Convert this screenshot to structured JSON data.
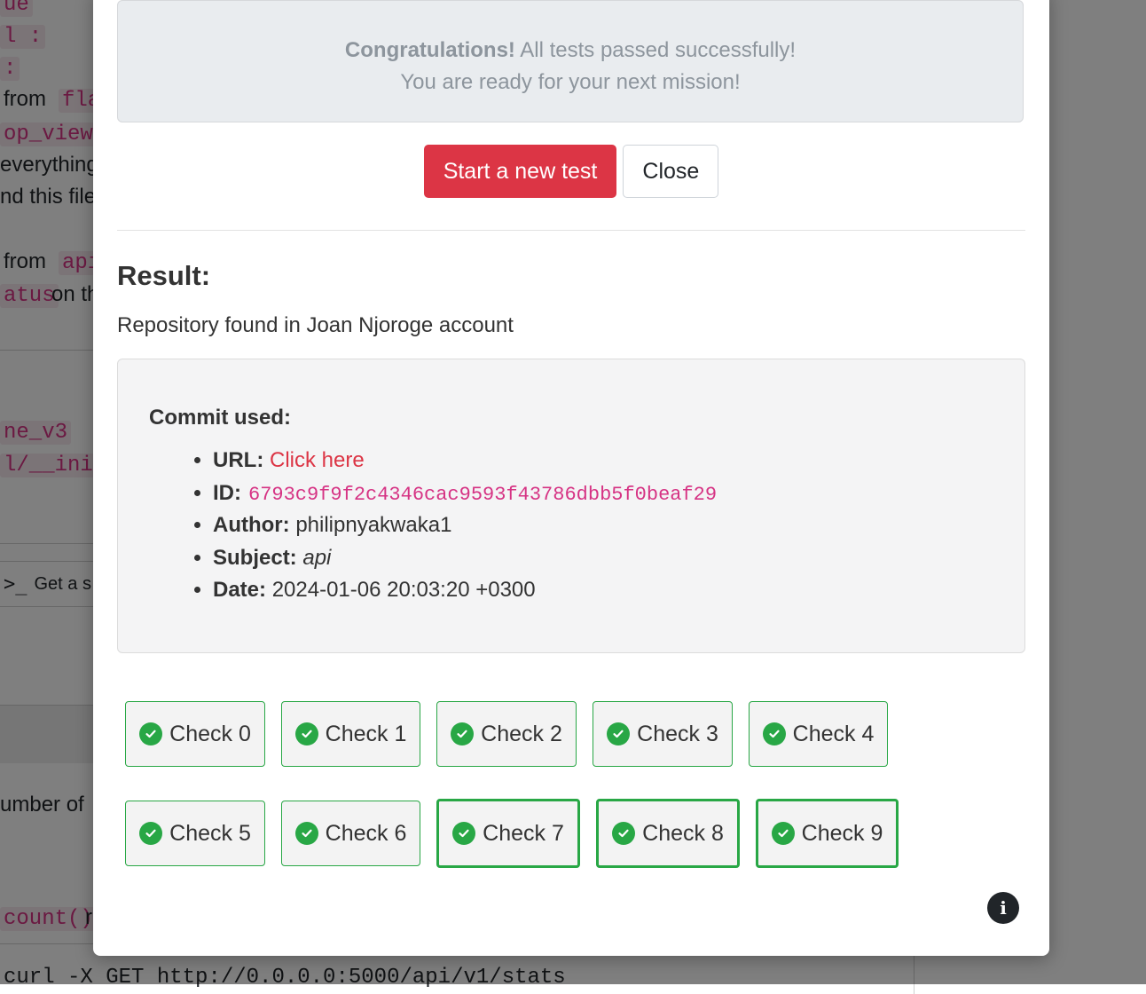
{
  "background": {
    "fragments": [
      "ue",
      "l :",
      ":",
      "from",
      "fla",
      "op_views",
      "everything",
      "nd this file",
      "from",
      "api",
      "atus",
      "on th",
      "ne_v3",
      "l/__init_",
      "Get a s",
      "umber of",
      "count()",
      "r",
      "curl -X GET http://0.0.0.0:5000/api/v1/stats"
    ]
  },
  "modal": {
    "alert": {
      "strong": "Congratulations!",
      "line1": " All tests passed successfully!",
      "line2": "You are ready for your next mission!"
    },
    "buttons": {
      "new_test": "Start a new test",
      "close": "Close"
    },
    "result": {
      "title": "Result:",
      "text": "Repository found in Joan Njoroge account"
    },
    "commit": {
      "label": "Commit used:",
      "url_label": "URL:",
      "url_text": "Click here",
      "id_label": "ID:",
      "id_value": "6793c9f9f2c4346cac9593f43786dbb5f0beaf29",
      "author_label": "Author:",
      "author_value": "philipnyakwaka1",
      "subject_label": "Subject:",
      "subject_value": "api",
      "date_label": "Date:",
      "date_value": "2024-01-06 20:03:20 +0300"
    },
    "checks": [
      "Check 0",
      "Check 1",
      "Check 2",
      "Check 3",
      "Check 4",
      "Check 5",
      "Check 6",
      "Check 7",
      "Check 8",
      "Check 9"
    ],
    "info_icon": "info-icon"
  },
  "colors": {
    "danger": "#dc3545",
    "success": "#28a745",
    "code": "#d63384"
  }
}
